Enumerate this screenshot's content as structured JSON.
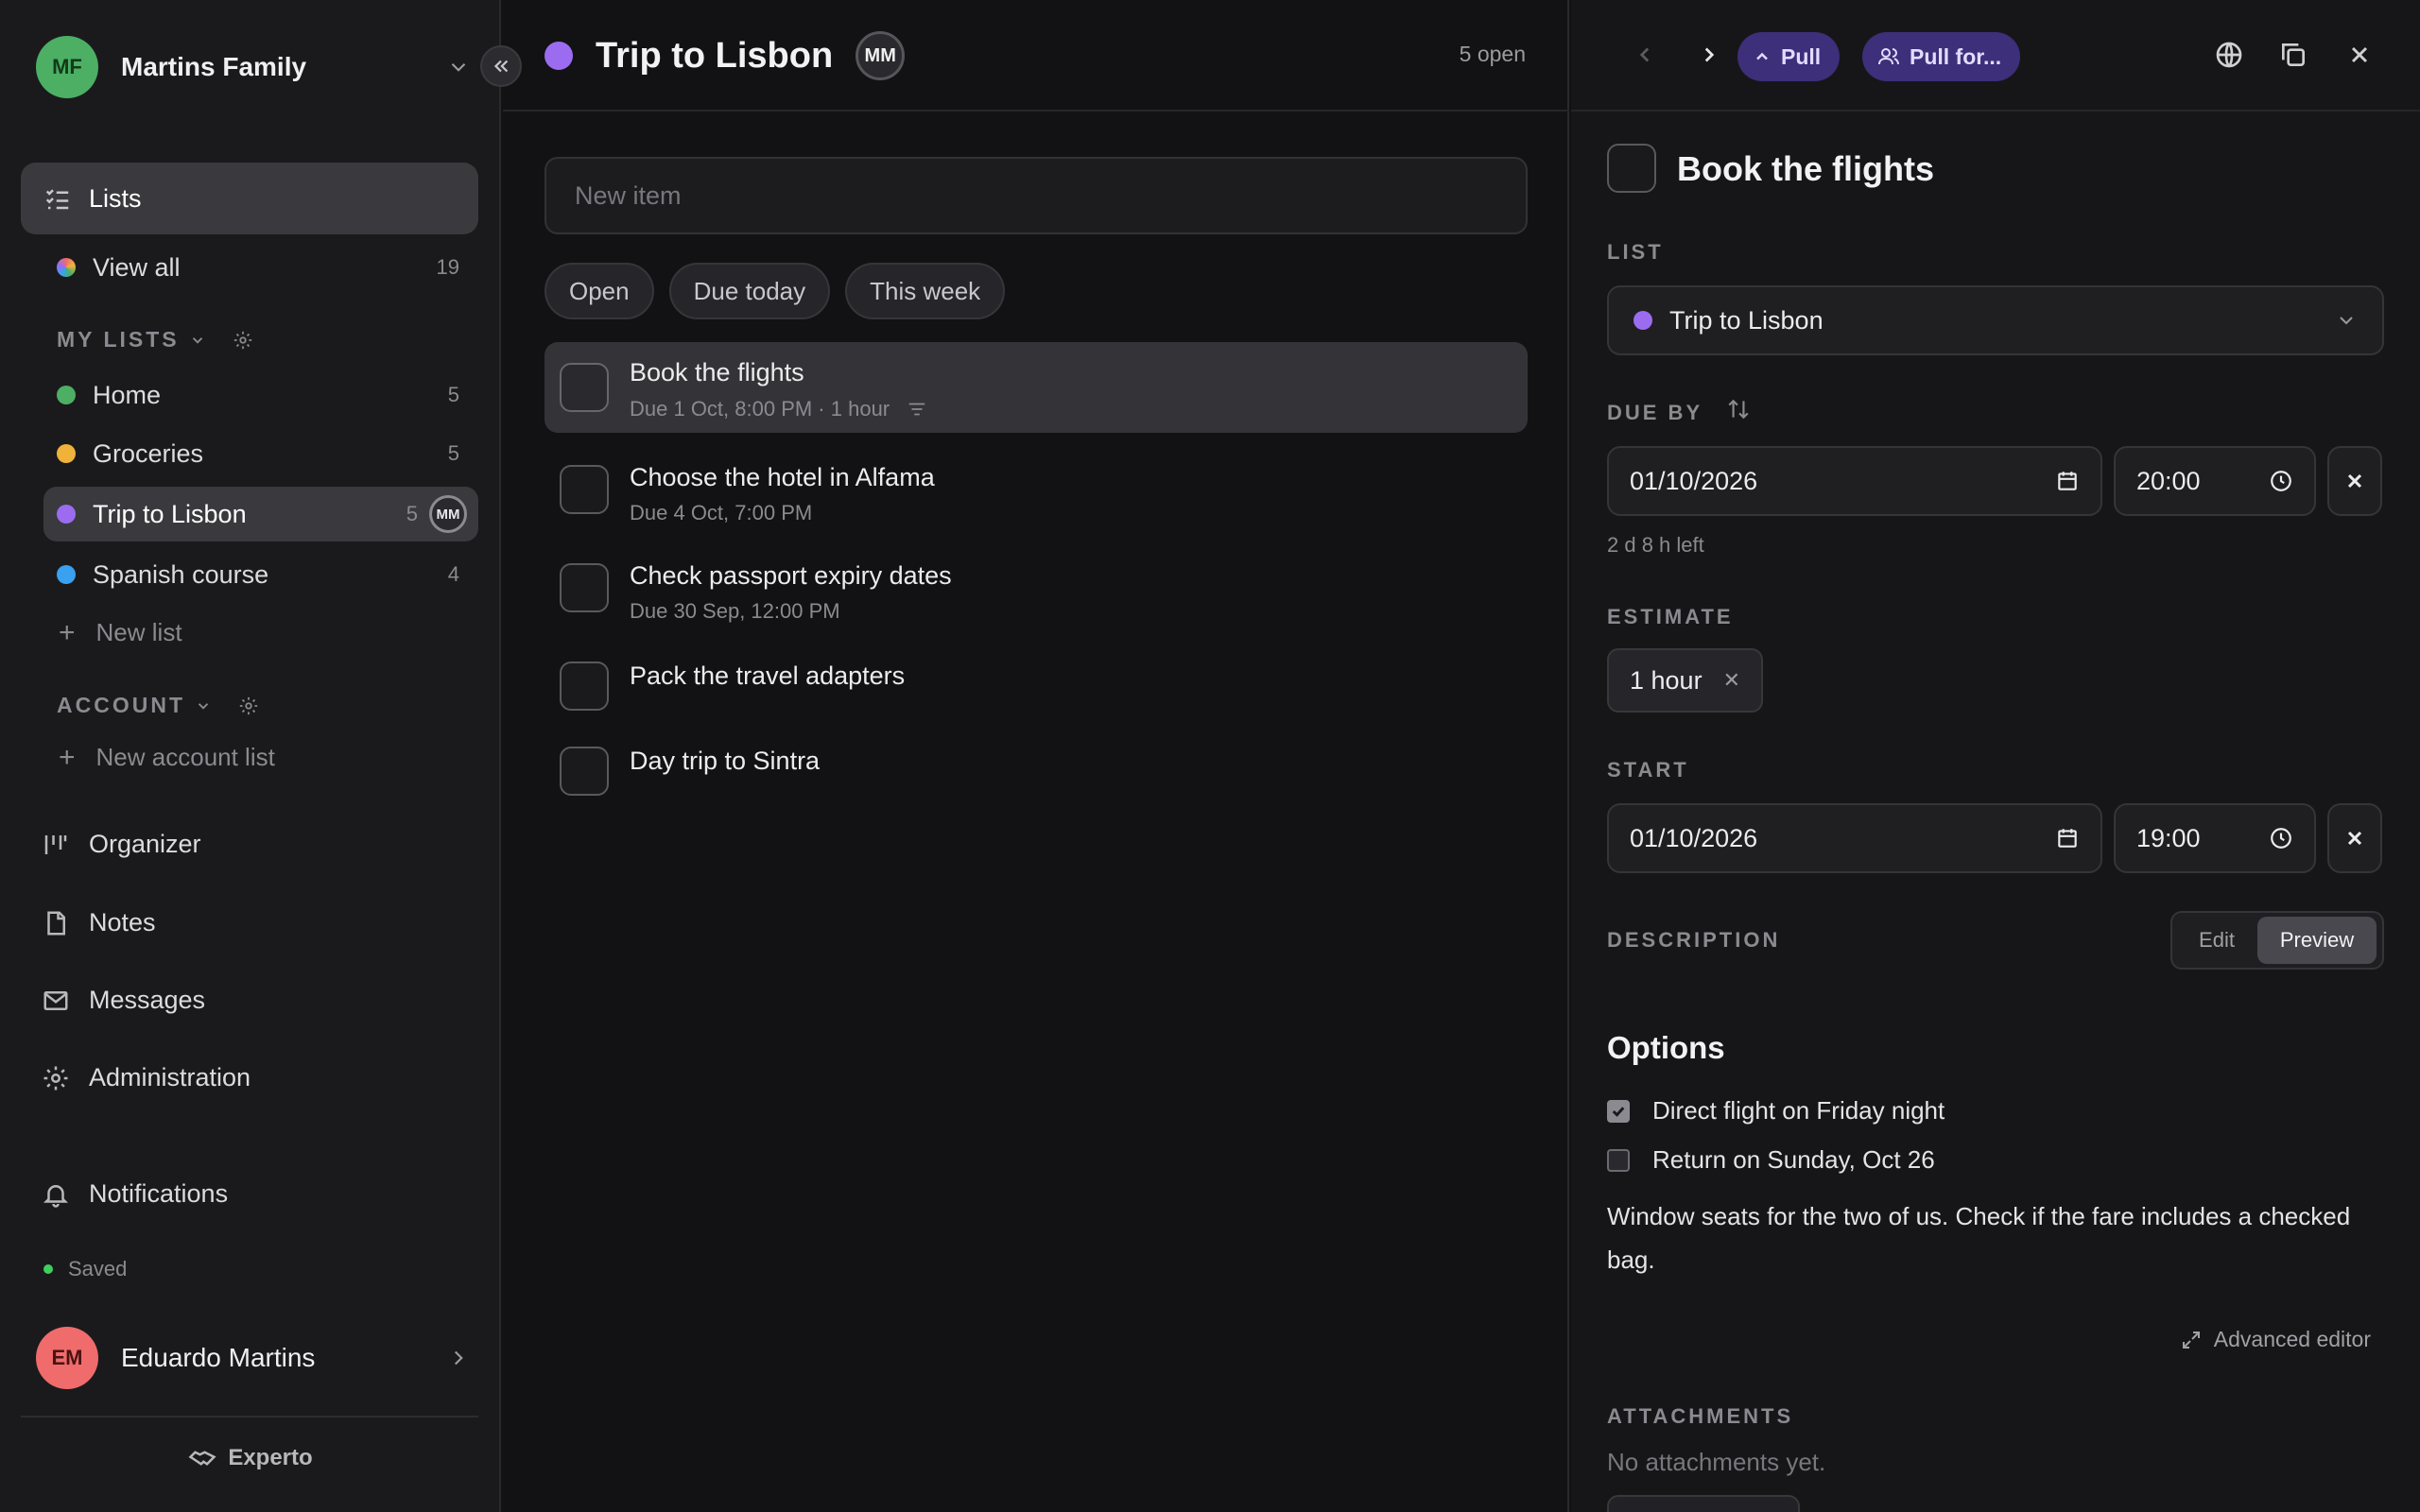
{
  "workspace": {
    "initials": "MF",
    "name": "Martins Family"
  },
  "sidebar": {
    "lists_label": "Lists",
    "view_all": {
      "label": "View all",
      "count": "19"
    },
    "my_lists_heading": "MY LISTS",
    "my_lists": [
      {
        "name": "Home",
        "count": "5",
        "color": "#4caf64"
      },
      {
        "name": "Groceries",
        "count": "5",
        "color": "#f0b23a"
      },
      {
        "name": "Trip to Lisbon",
        "count": "5",
        "color": "#9b6cf0",
        "active": true,
        "member": "MM"
      },
      {
        "name": "Spanish course",
        "count": "4",
        "color": "#3aa0f0"
      }
    ],
    "new_list": "New list",
    "account_heading": "ACCOUNT",
    "new_account_list": "New account list",
    "nav": [
      {
        "label": "Organizer",
        "icon": "organizer-icon"
      },
      {
        "label": "Notes",
        "icon": "note-icon"
      },
      {
        "label": "Messages",
        "icon": "mail-icon"
      },
      {
        "label": "Administration",
        "icon": "gear-icon"
      }
    ],
    "notifications": "Notifications",
    "saved_status": "Saved",
    "user": {
      "initials": "EM",
      "name": "Eduardo Martins"
    },
    "brand": "Experto"
  },
  "middle": {
    "title": "Trip to Lisbon",
    "title_color": "#9b6cf0",
    "member_initials": "MM",
    "open_count": "5 open",
    "new_item_placeholder": "New item",
    "filters": [
      "Open",
      "Due today",
      "This week"
    ],
    "tasks": [
      {
        "title": "Book the flights",
        "meta": "Due 1 Oct, 8:00 PM · 1 hour",
        "selected": true,
        "has_description": true
      },
      {
        "title": "Choose the hotel in Alfama",
        "meta": "Due 4 Oct, 7:00 PM"
      },
      {
        "title": "Check passport expiry dates",
        "meta": "Due 30 Sep, 12:00 PM"
      },
      {
        "title": "Pack the travel adapters",
        "meta": ""
      },
      {
        "title": "Day trip to Sintra",
        "meta": ""
      }
    ]
  },
  "detail": {
    "pull_label": "Pull",
    "pull_for_label": "Pull for...",
    "title": "Book the flights",
    "list_label": "LIST",
    "list_value": "Trip to Lisbon",
    "list_color": "#9b6cf0",
    "due_label": "DUE BY",
    "due_date": "01/10/2026",
    "due_time": "20:00",
    "time_left": "2 d 8 h left",
    "estimate_label": "ESTIMATE",
    "estimate_value": "1 hour",
    "start_label": "START",
    "start_date": "01/10/2026",
    "start_time": "19:00",
    "description_label": "DESCRIPTION",
    "edit_tab": "Edit",
    "preview_tab": "Preview",
    "options_heading": "Options",
    "options": [
      {
        "label": "Direct flight on Friday night",
        "checked": true
      },
      {
        "label": "Return on Sunday, Oct 26",
        "checked": false
      }
    ],
    "description_text": "Window seats for the two of us. Check if the fare includes a checked bag.",
    "advanced_editor": "Advanced editor",
    "attachments_label": "ATTACHMENTS",
    "no_attachments": "No attachments yet."
  }
}
